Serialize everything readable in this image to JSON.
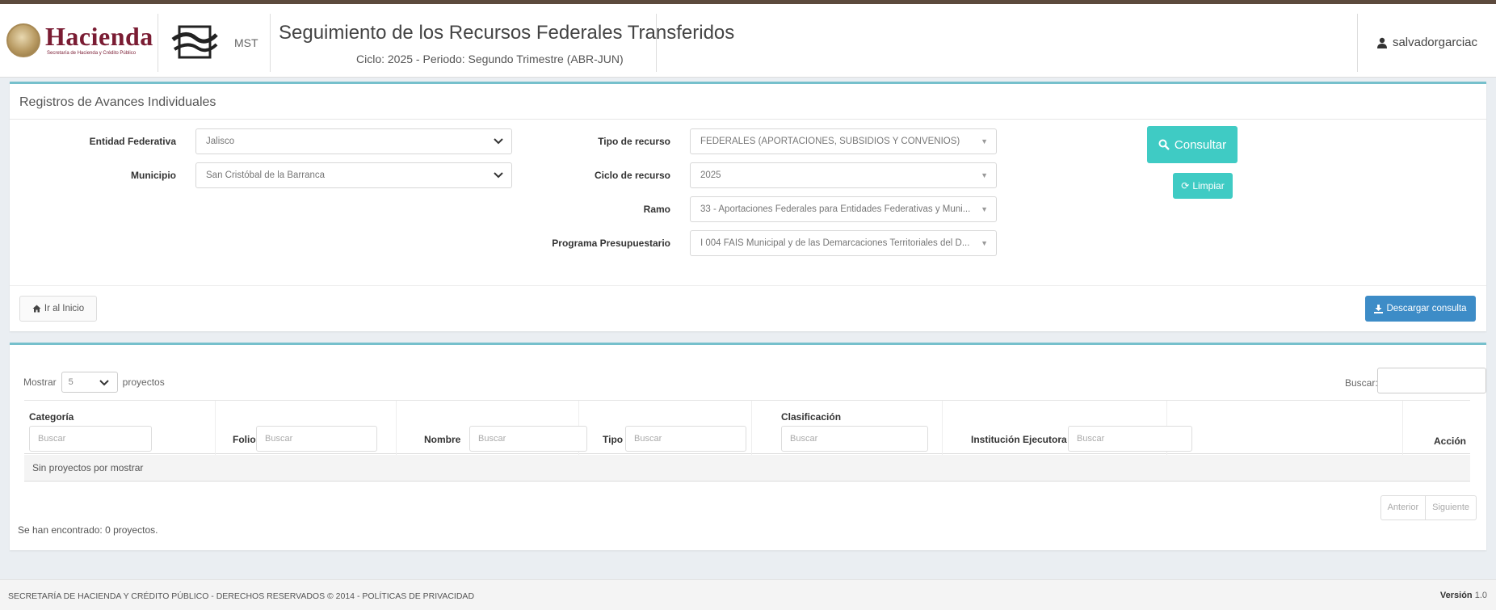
{
  "header": {
    "brand_name": "Hacienda",
    "brand_subtitle": "Secretaría de Hacienda y Crédito Público",
    "mst_label": "MST",
    "title": "Seguimiento de los Recursos Federales Transferidos",
    "subtitle": "Ciclo: 2025 - Periodo: Segundo Trimestre (ABR-JUN)",
    "user": "salvadorgarciac",
    "user_icon": "user-icon"
  },
  "filters_panel": {
    "title": "Registros de Avances Individuales",
    "entidad": {
      "label": "Entidad Federativa",
      "value": "Jalisco"
    },
    "municipio": {
      "label": "Municipio",
      "value": "San Cristóbal de la Barranca"
    },
    "tipo_recurso": {
      "label": "Tipo de recurso",
      "value": "FEDERALES (APORTACIONES, SUBSIDIOS Y CONVENIOS)"
    },
    "ciclo_recurso": {
      "label": "Ciclo de recurso",
      "value": "2025"
    },
    "ramo": {
      "label": "Ramo",
      "value": "33 - Aportaciones Federales para Entidades Federativas y Muni..."
    },
    "programa": {
      "label": "Programa Presupuestario",
      "value": "I 004 FAIS Municipal y de las Demarcaciones Territoriales del D..."
    },
    "consultar_label": "Consultar",
    "limpiar_label": "Limpiar",
    "inicio_label": "Ir al Inicio",
    "descargar_label": "Descargar consulta"
  },
  "table_panel": {
    "mostrar_label": "Mostrar",
    "page_length": "5",
    "proyectos_label": "proyectos",
    "buscar_label": "Buscar:",
    "columns": {
      "categoria": "Categoría",
      "folio": "Folio",
      "nombre": "Nombre",
      "tipo": "Tipo",
      "clasificacion": "Clasificación",
      "institucion": "Institución Ejecutora",
      "accion": "Acción"
    },
    "filter_placeholder": "Buscar",
    "empty_message": "Sin proyectos por mostrar",
    "prev_label": "Anterior",
    "next_label": "Siguiente",
    "info": "Se han encontrado: 0 proyectos."
  },
  "footer": {
    "text": "SECRETARÍA DE HACIENDA Y CRÉDITO PÚBLICO - DERECHOS RESERVADOS © 2014 - POLÍTICAS DE PRIVACIDAD",
    "version_label": "Versión",
    "version": "1.0"
  },
  "colors": {
    "brand": "#7a1c33",
    "accent_teal": "#3fcbc4",
    "primary_blue": "#3d8cc7",
    "panel_top_border": "#76c0cc"
  }
}
